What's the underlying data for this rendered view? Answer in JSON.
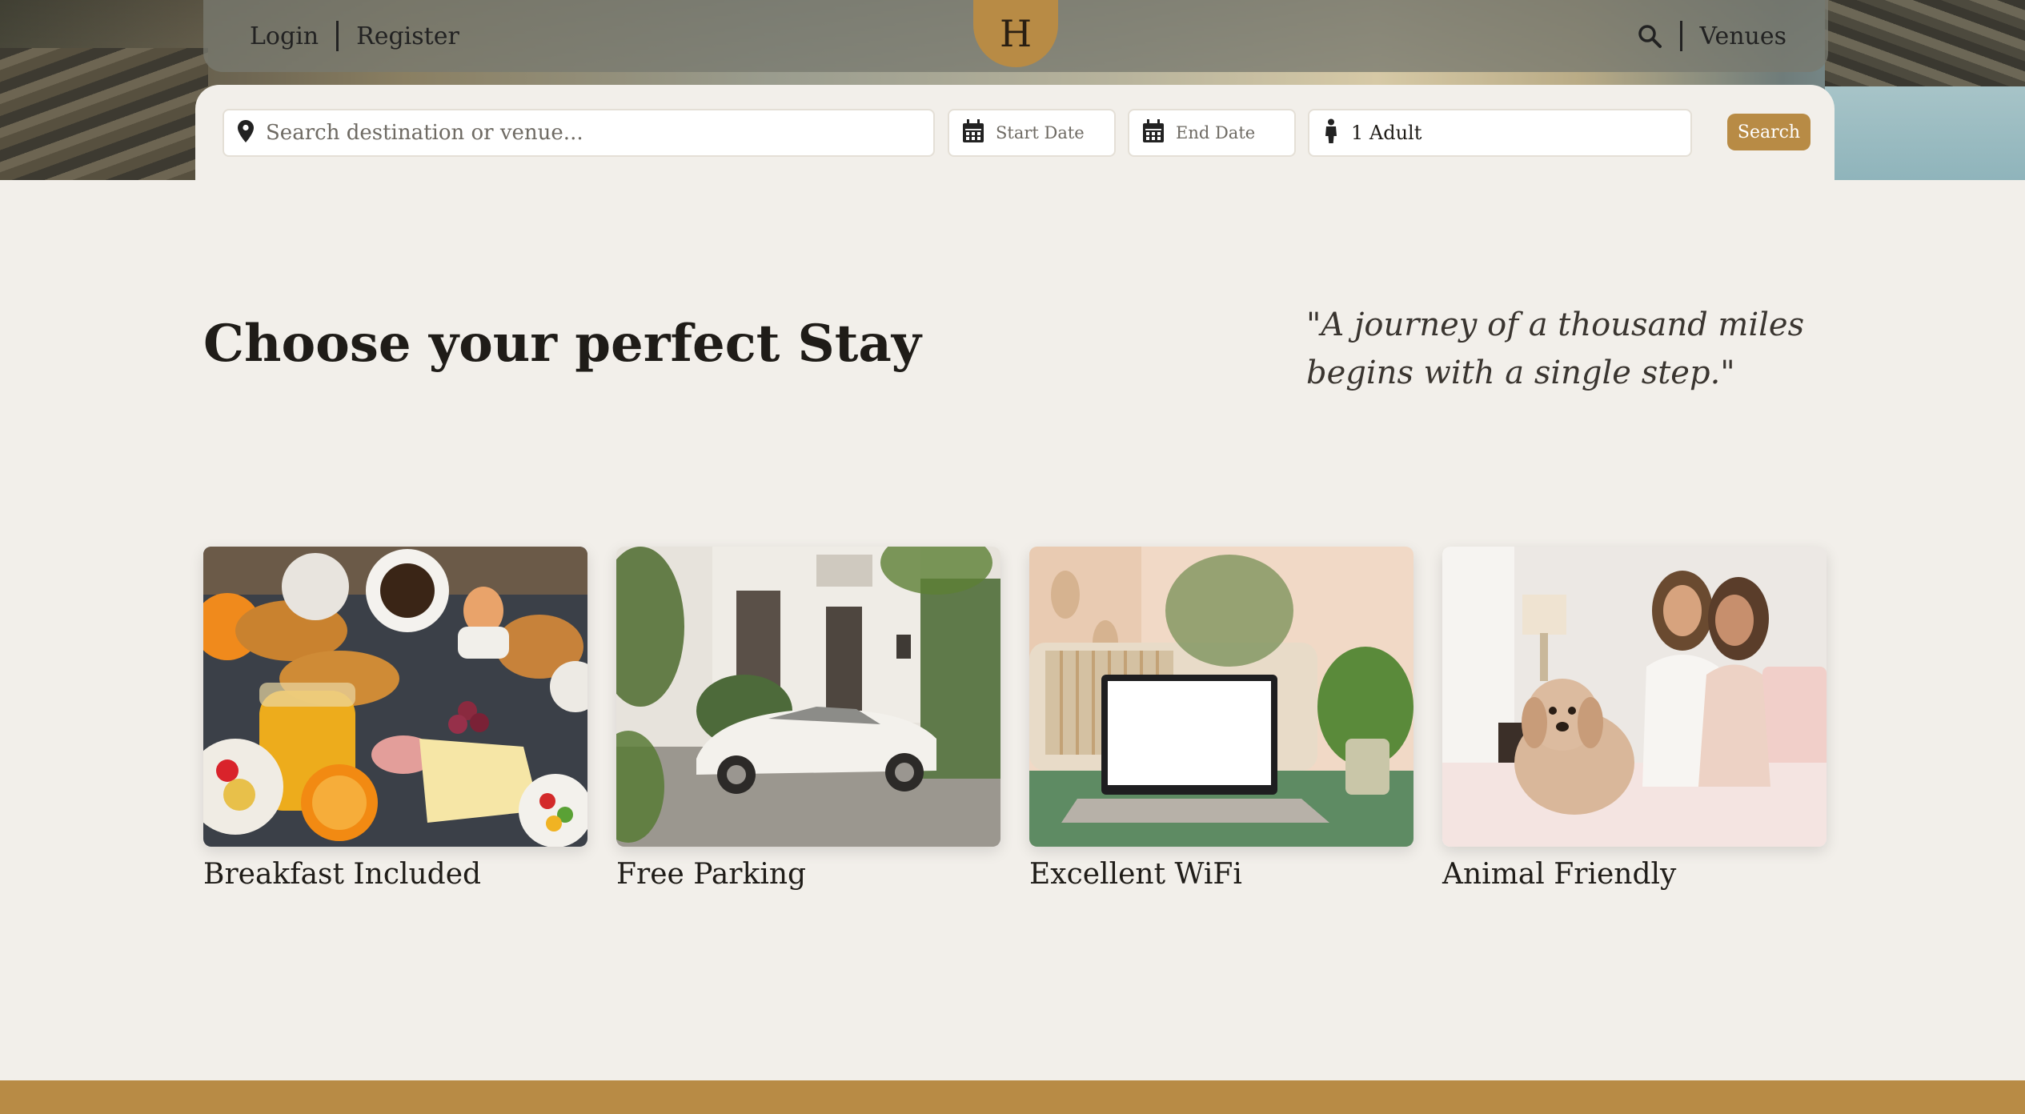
{
  "nav": {
    "login": "Login",
    "register": "Register",
    "logo_letter": "H",
    "venues": "Venues"
  },
  "search": {
    "destination_placeholder": "Search destination or venue...",
    "start_date_placeholder": "Start Date",
    "end_date_placeholder": "End Date",
    "guests_value": "1 Adult",
    "button_label": "Search"
  },
  "main": {
    "title": "Choose your perfect Stay",
    "quote": "\"A journey of a thousand miles begins with a single step.\""
  },
  "features": [
    {
      "label": "Breakfast Included",
      "image": "breakfast-photo"
    },
    {
      "label": "Free Parking",
      "image": "parking-photo"
    },
    {
      "label": "Excellent WiFi",
      "image": "wifi-photo"
    },
    {
      "label": "Animal Friendly",
      "image": "animal-photo"
    }
  ],
  "colors": {
    "accent": "#b88b45",
    "background": "#f2efea",
    "text": "#1f1c18"
  },
  "icons": [
    "search-icon",
    "map-pin-icon",
    "calendar-icon",
    "person-icon"
  ]
}
